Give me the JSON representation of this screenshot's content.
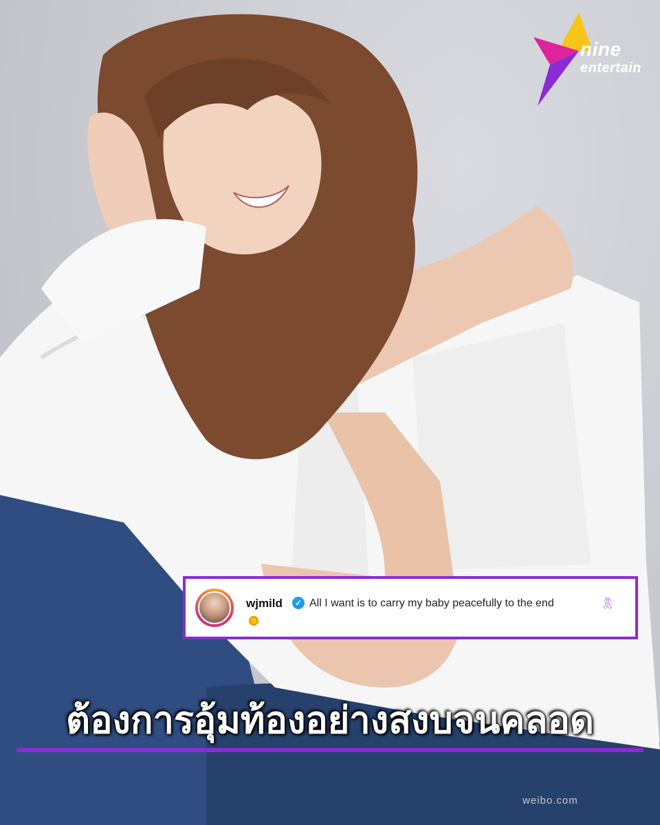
{
  "brand": {
    "logo_line1": "nine",
    "logo_line2": "entertain",
    "logo_colors": {
      "purple": "#8b2bd6",
      "pink": "#e0239a",
      "gold": "#f5c518"
    }
  },
  "post_caption": {
    "username": "wjmild",
    "verified_icon": "verified-badge-icon",
    "text": "All I want is to carry my baby peacefully to the end",
    "ribbon_icon": "purple-ribbon-icon",
    "sunflower_icon": "sunflower-emoji-icon",
    "border_color": "#8b2bd6"
  },
  "headline": {
    "text": "ต้องการอุ้มท้องอย่างสงบจนคลอด",
    "underline_color": "#8b2bd6"
  },
  "watermark": {
    "text": "weibo.com"
  },
  "photo": {
    "icon": "portrait-photo"
  }
}
